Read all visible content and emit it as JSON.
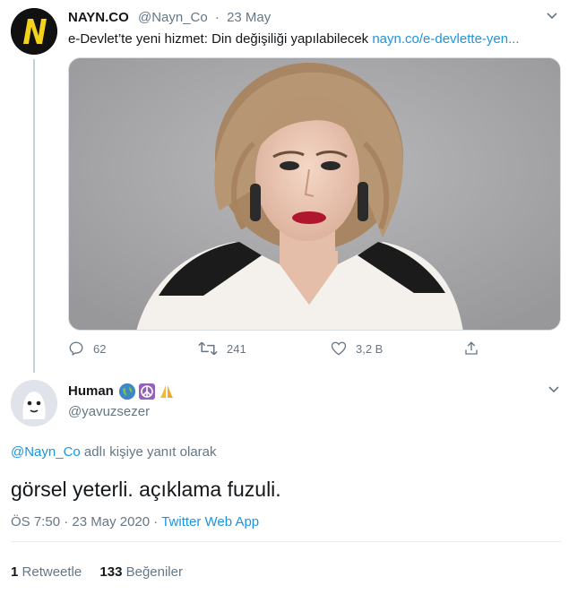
{
  "original_tweet": {
    "author_name": "NAYN.CO",
    "author_handle": "@Nayn_Co",
    "separator": "·",
    "date": "23 May",
    "text": "e-Devlet’te yeni hizmet: Din değişiliği yapılabilecek ",
    "link_text": "nayn.co/e-devlette-yen...",
    "avatar_letter": "N",
    "actions": {
      "reply_count": "62",
      "retweet_count": "241",
      "like_count": "3,2 B"
    }
  },
  "reply_tweet": {
    "author_name": "Human",
    "author_handle": "@yavuzsezer",
    "name_emojis": [
      "globe-emoji",
      "peace-emoji",
      "pray-emoji"
    ],
    "replying_to_handle": "@Nayn_Co",
    "replying_to_suffix": " adlı kişiye yanıt olarak",
    "text": "görsel yeterli. açıklama fuzuli.",
    "time": "ÖS 7:50",
    "meta_separator": " · ",
    "date": "23 May 2020",
    "source": "Twitter Web App",
    "retweet_count": "1",
    "retweet_label": "Retweetle",
    "like_count": "133",
    "like_label": "Beğeniler"
  },
  "colors": {
    "link": "#1b95e0",
    "muted": "#657786",
    "text": "#14171a",
    "brand_yellow": "#f5d21c"
  },
  "icons": [
    "chevron-down-icon",
    "reply-icon",
    "retweet-icon",
    "like-icon",
    "share-icon"
  ]
}
